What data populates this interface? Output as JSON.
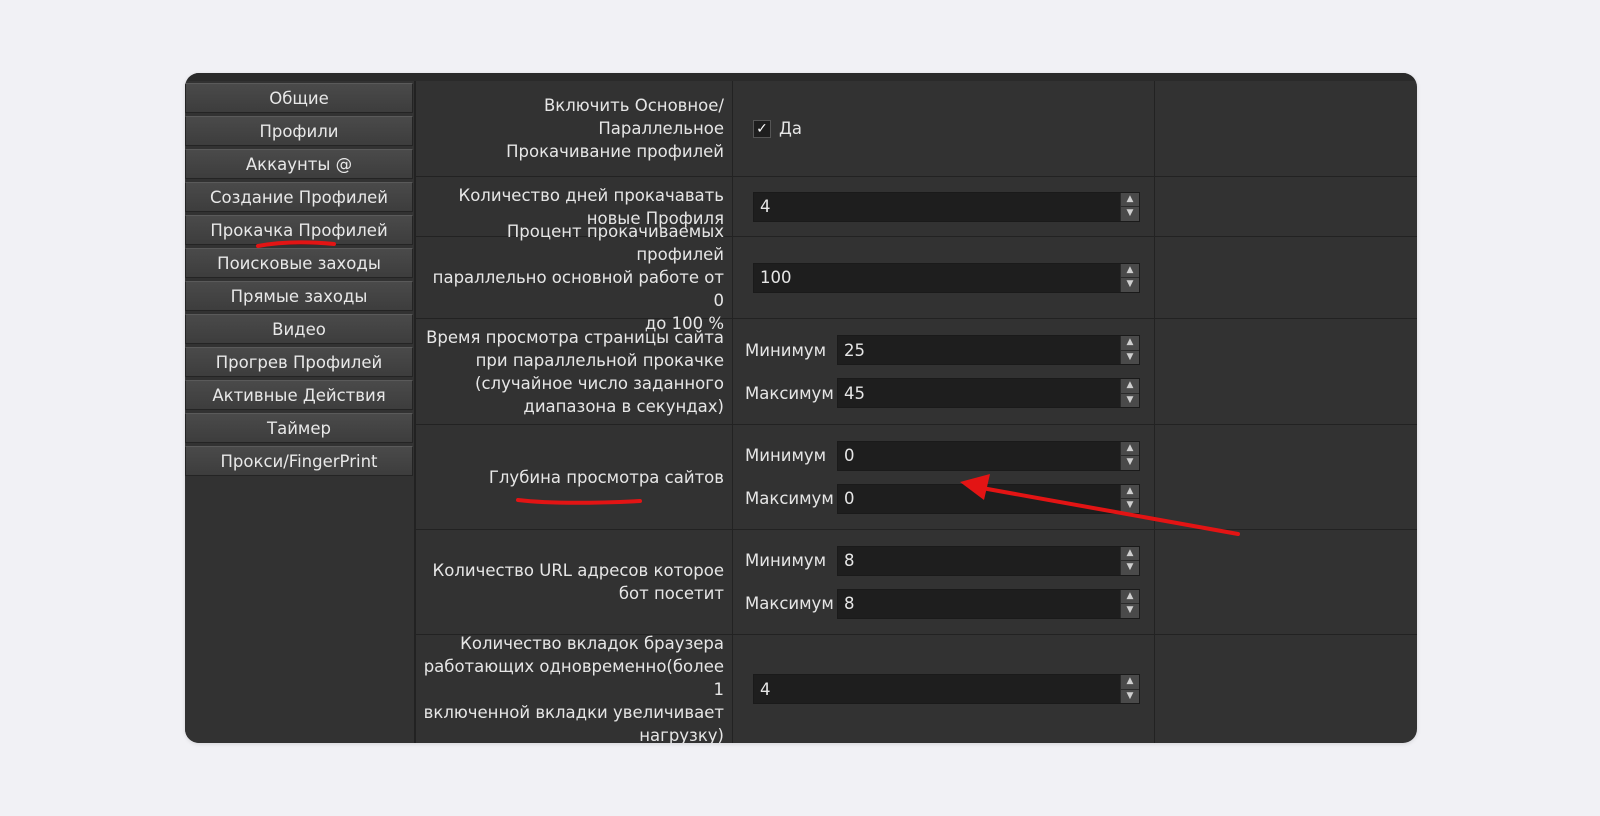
{
  "sidebar": {
    "items": [
      {
        "label": "Общие"
      },
      {
        "label": "Профили"
      },
      {
        "label": "Аккаунты @"
      },
      {
        "label": "Создание Профилей"
      },
      {
        "label": "Прокачка Профилей"
      },
      {
        "label": "Поисковые заходы"
      },
      {
        "label": "Прямые заходы"
      },
      {
        "label": "Видео"
      },
      {
        "label": "Прогрев Профилей"
      },
      {
        "label": "Активные Действия"
      },
      {
        "label": "Таймер"
      },
      {
        "label": "Прокси/FingerPrint"
      }
    ]
  },
  "settings": {
    "enable": {
      "label_1": "Включить Основное/Параллельное",
      "label_2": "Прокачивание профилей",
      "check_mark": "✓",
      "check_label": "Да"
    },
    "days": {
      "label_1": "Количество дней прокачавать",
      "label_2": "новые Профиля",
      "value": "4"
    },
    "percent": {
      "label_1": "Процент прокачиваемых профилей",
      "label_2": "параллельно основной работе от 0",
      "label_3": "до 100 %",
      "value": "100"
    },
    "view_time": {
      "label_1": "Время просмотра страницы сайта",
      "label_2": "при параллельной прокачке",
      "label_3": "(случайное число заданного",
      "label_4": "диапазона в секундах)",
      "min_label": "Минимум",
      "min": "25",
      "max_label": "Максимум",
      "max": "45"
    },
    "depth": {
      "label_1": "Глубина просмотра сайтов",
      "min_label": "Минимум",
      "min": "0",
      "max_label": "Максимум",
      "max": "0"
    },
    "urls": {
      "label_1": "Количество URL адресов которое",
      "label_2": "бот посетит",
      "min_label": "Минимум",
      "min": "8",
      "max_label": "Максимум",
      "max": "8"
    },
    "tabs": {
      "label_1": "Количество вкладок браузера",
      "label_2": "работающих одновременно(более 1",
      "label_3": "включенной вкладки увеличивает",
      "label_4": "нагрузку)",
      "value": "4"
    }
  },
  "spin_icons": {
    "up": "up-arrow-icon",
    "down": "down-arrow-icon"
  },
  "colors": {
    "annotation": "#e31414",
    "window_bg": "#323232",
    "field_bg": "#1e1e1e"
  }
}
